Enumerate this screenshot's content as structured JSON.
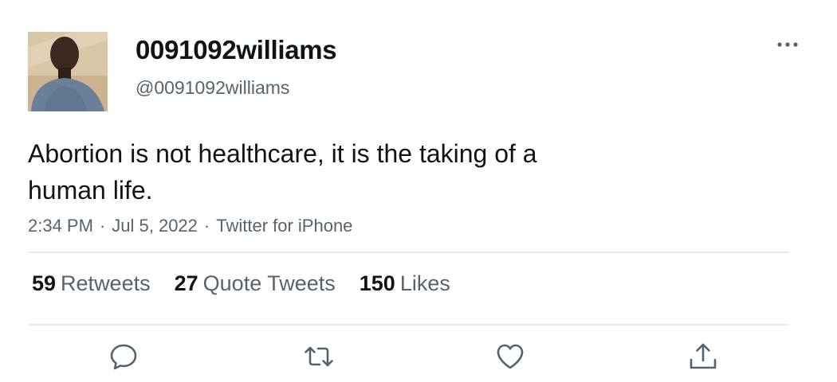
{
  "tweet": {
    "author": {
      "display_name": "0091092williams",
      "handle": "@0091092williams",
      "avatar_icon": "profile-photo"
    },
    "text_line_1": "Abortion is not healthcare, it is the taking of a",
    "text_line_2": "human life.",
    "meta": {
      "time": "2:34 PM",
      "separator": "·",
      "date": "Jul 5, 2022",
      "source": "Twitter for iPhone"
    },
    "stats": {
      "retweets_count": "59",
      "retweets_label": "Retweets",
      "quotes_count": "27",
      "quotes_label": "Quote Tweets",
      "likes_count": "150",
      "likes_label": "Likes"
    },
    "actions": [
      {
        "icon": "reply-icon"
      },
      {
        "icon": "retweet-icon"
      },
      {
        "icon": "like-icon"
      },
      {
        "icon": "share-icon"
      }
    ],
    "colors": {
      "text_primary": "#0f1419",
      "text_secondary": "#536471",
      "divider": "#e6e9ec",
      "background": "#ffffff"
    }
  }
}
